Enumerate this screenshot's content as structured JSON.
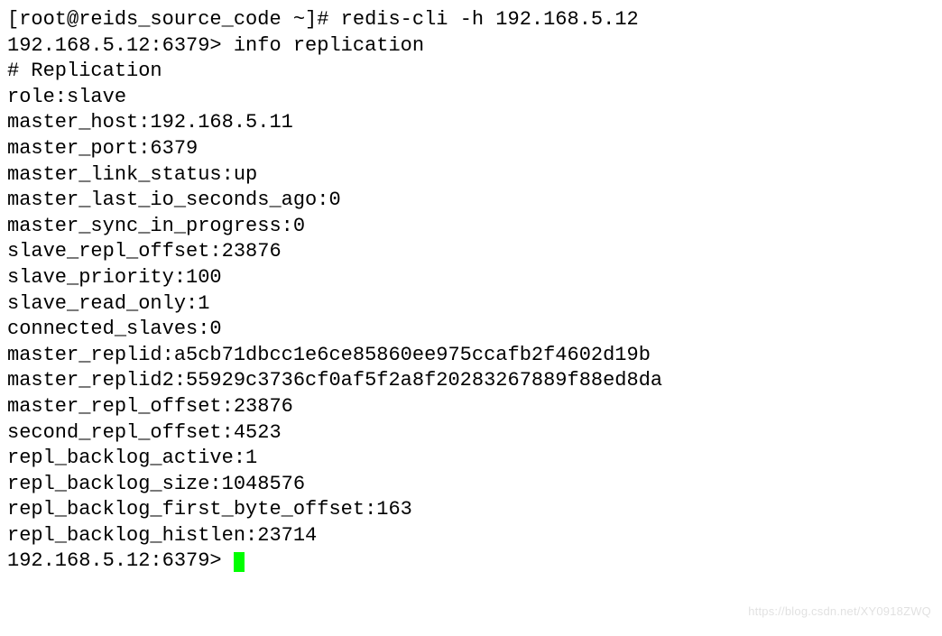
{
  "terminal": {
    "prompt1": "[root@reids_source_code ~]# ",
    "cmd1": "redis-cli -h 192.168.5.12",
    "prompt2": "192.168.5.12:6379> ",
    "cmd2": "info replication",
    "section_header": "# Replication",
    "fields": {
      "role": "role:slave",
      "master_host": "master_host:192.168.5.11",
      "master_port": "master_port:6379",
      "master_link_status": "master_link_status:up",
      "master_last_io_seconds_ago": "master_last_io_seconds_ago:0",
      "master_sync_in_progress": "master_sync_in_progress:0",
      "slave_repl_offset": "slave_repl_offset:23876",
      "slave_priority": "slave_priority:100",
      "slave_read_only": "slave_read_only:1",
      "connected_slaves": "connected_slaves:0",
      "master_replid": "master_replid:a5cb71dbcc1e6ce85860ee975ccafb2f4602d19b",
      "master_replid2": "master_replid2:55929c3736cf0af5f2a8f20283267889f88ed8da",
      "master_repl_offset": "master_repl_offset:23876",
      "second_repl_offset": "second_repl_offset:4523",
      "repl_backlog_active": "repl_backlog_active:1",
      "repl_backlog_size": "repl_backlog_size:1048576",
      "repl_backlog_first_byte_offset": "repl_backlog_first_byte_offset:163",
      "repl_backlog_histlen": "repl_backlog_histlen:23714"
    },
    "prompt3": "192.168.5.12:6379> "
  },
  "watermark": "https://blog.csdn.net/XY0918ZWQ"
}
